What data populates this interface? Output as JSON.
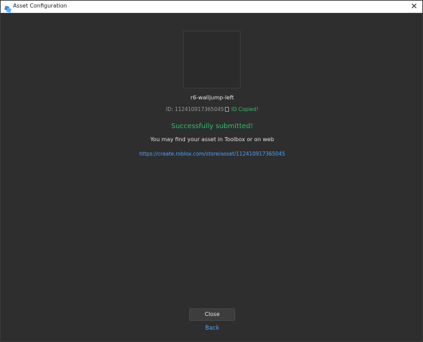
{
  "window": {
    "title": "Asset Configuration",
    "close_glyph": "✕"
  },
  "asset": {
    "name": "r6-walljump-left",
    "id_text": "ID: 112410917365045",
    "copied_text": "ID Copied!"
  },
  "status": {
    "success_text": "Successfully submitted!",
    "hint_text": "You may find your asset in Toolbox or on web",
    "url": "https://create.roblox.com/store/asset/112410917365045"
  },
  "footer": {
    "close_label": "Close",
    "back_label": "Back"
  },
  "colors": {
    "background": "#2e2e2e",
    "success": "#2fbf6a",
    "link": "#4aa3ff",
    "app_icon": "#2b8ae6"
  },
  "icons": {
    "app": "roblox-studio-icon",
    "copy": "copy-icon",
    "close": "close-icon"
  }
}
